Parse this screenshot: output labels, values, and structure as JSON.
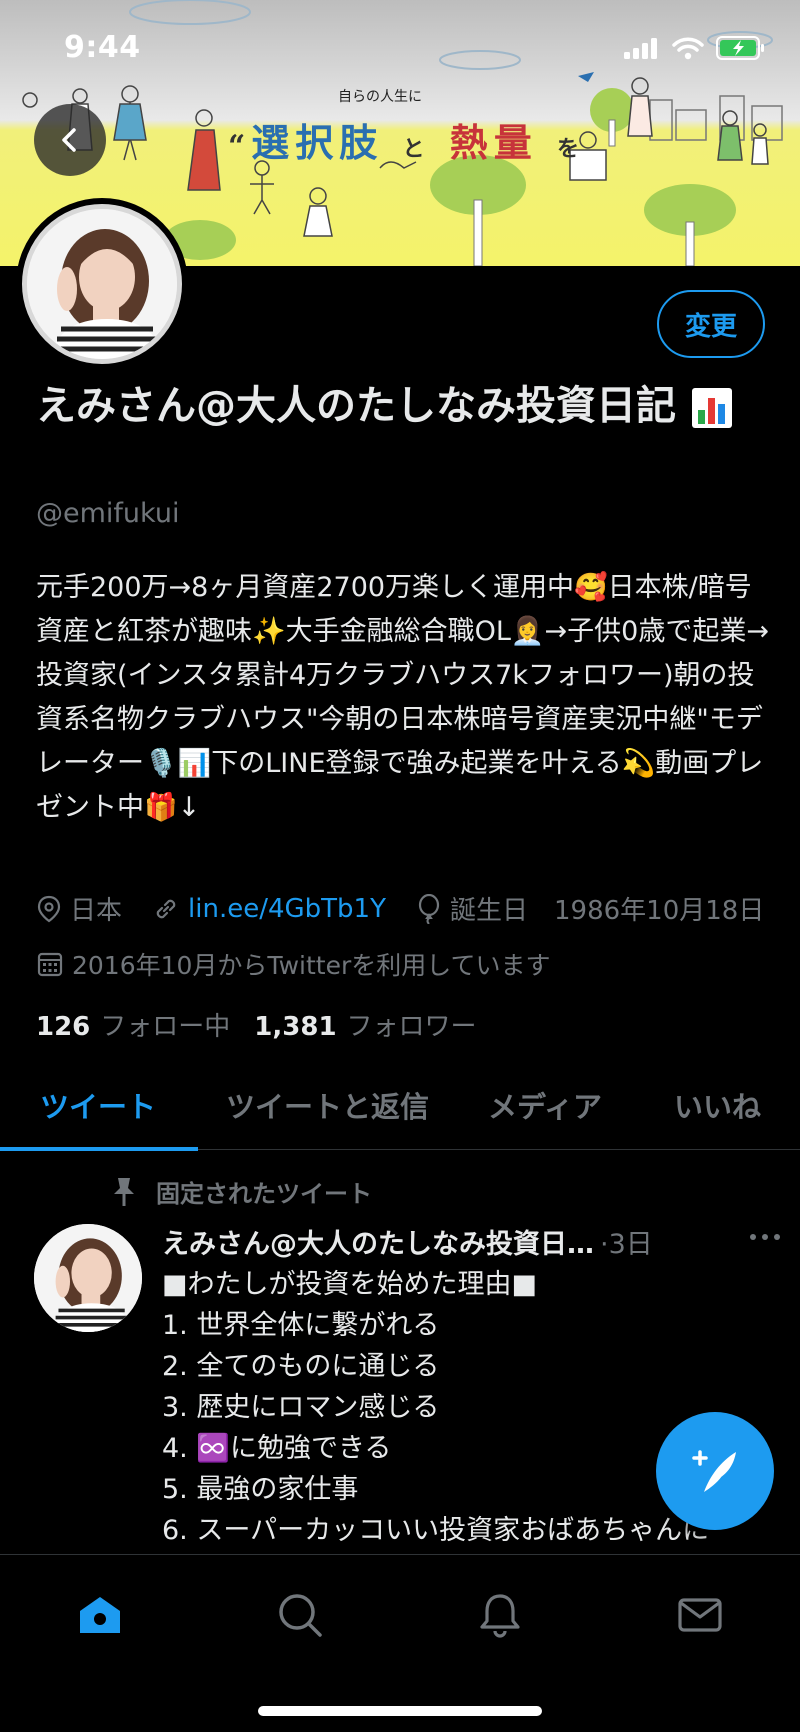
{
  "status_bar": {
    "time": "9:44"
  },
  "banner": {
    "subtitle": "自らの人生に",
    "headline_word1": "選択肢",
    "headline_particle1": "と",
    "headline_word2": "熱量",
    "headline_particle2": "を"
  },
  "profile": {
    "edit_label": "変更",
    "display_name": "えみさん@大人のたしなみ投資日記",
    "handle": "@emifukui",
    "bio": "元手200万→8ヶ月資産2700万楽しく運用中🥰日本株/暗号資産と紅茶が趣味✨大手金融総合職OL👩‍💼→子供0歳で起業→投資家(インスタ累計4万クラブハウス7kフォロワー)朝の投資系名物クラブハウス\"今朝の日本株暗号資産実況中継\"モデレーター🎙️📊下のLINE登録で強み起業を叶える💫動画プレゼント中🎁↓",
    "location": "日本",
    "link": "lin.ee/4GbTb1Y",
    "birthday_label": "誕生日",
    "birthday": "1986年10月18日",
    "joined": "2016年10月からTwitterを利用しています",
    "following_count": "126",
    "following_label": "フォロー中",
    "followers_count": "1,381",
    "followers_label": "フォロワー"
  },
  "tabs": [
    "ツイート",
    "ツイートと返信",
    "メディア",
    "いいね"
  ],
  "pinned_tweet": {
    "pinned_label": "固定されたツイート",
    "author": "えみさん@大人のたしなみ投資日…",
    "time": "·3日",
    "lines": [
      "■わたしが投資を始めた理由■",
      "1.  世界全体に繋がれる",
      "2. 全てのものに通じる",
      "3. 歴史にロマン感じる",
      "4. ♾️に勉強できる",
      "5. 最強の家仕事",
      "6. スーパーカッコいい投資家おばあちゃんに"
    ]
  },
  "colors": {
    "accent": "#1d9bf0",
    "background": "#000000",
    "muted": "#71767b"
  },
  "icons": {
    "back": "arrow-left-icon",
    "location": "location-pin-icon",
    "link": "link-icon",
    "birthday": "balloon-icon",
    "calendar": "calendar-icon",
    "pin": "pin-icon",
    "more": "more-icon",
    "compose": "compose-feather-icon",
    "nav": [
      "home-icon",
      "search-icon",
      "bell-icon",
      "mail-icon"
    ]
  }
}
